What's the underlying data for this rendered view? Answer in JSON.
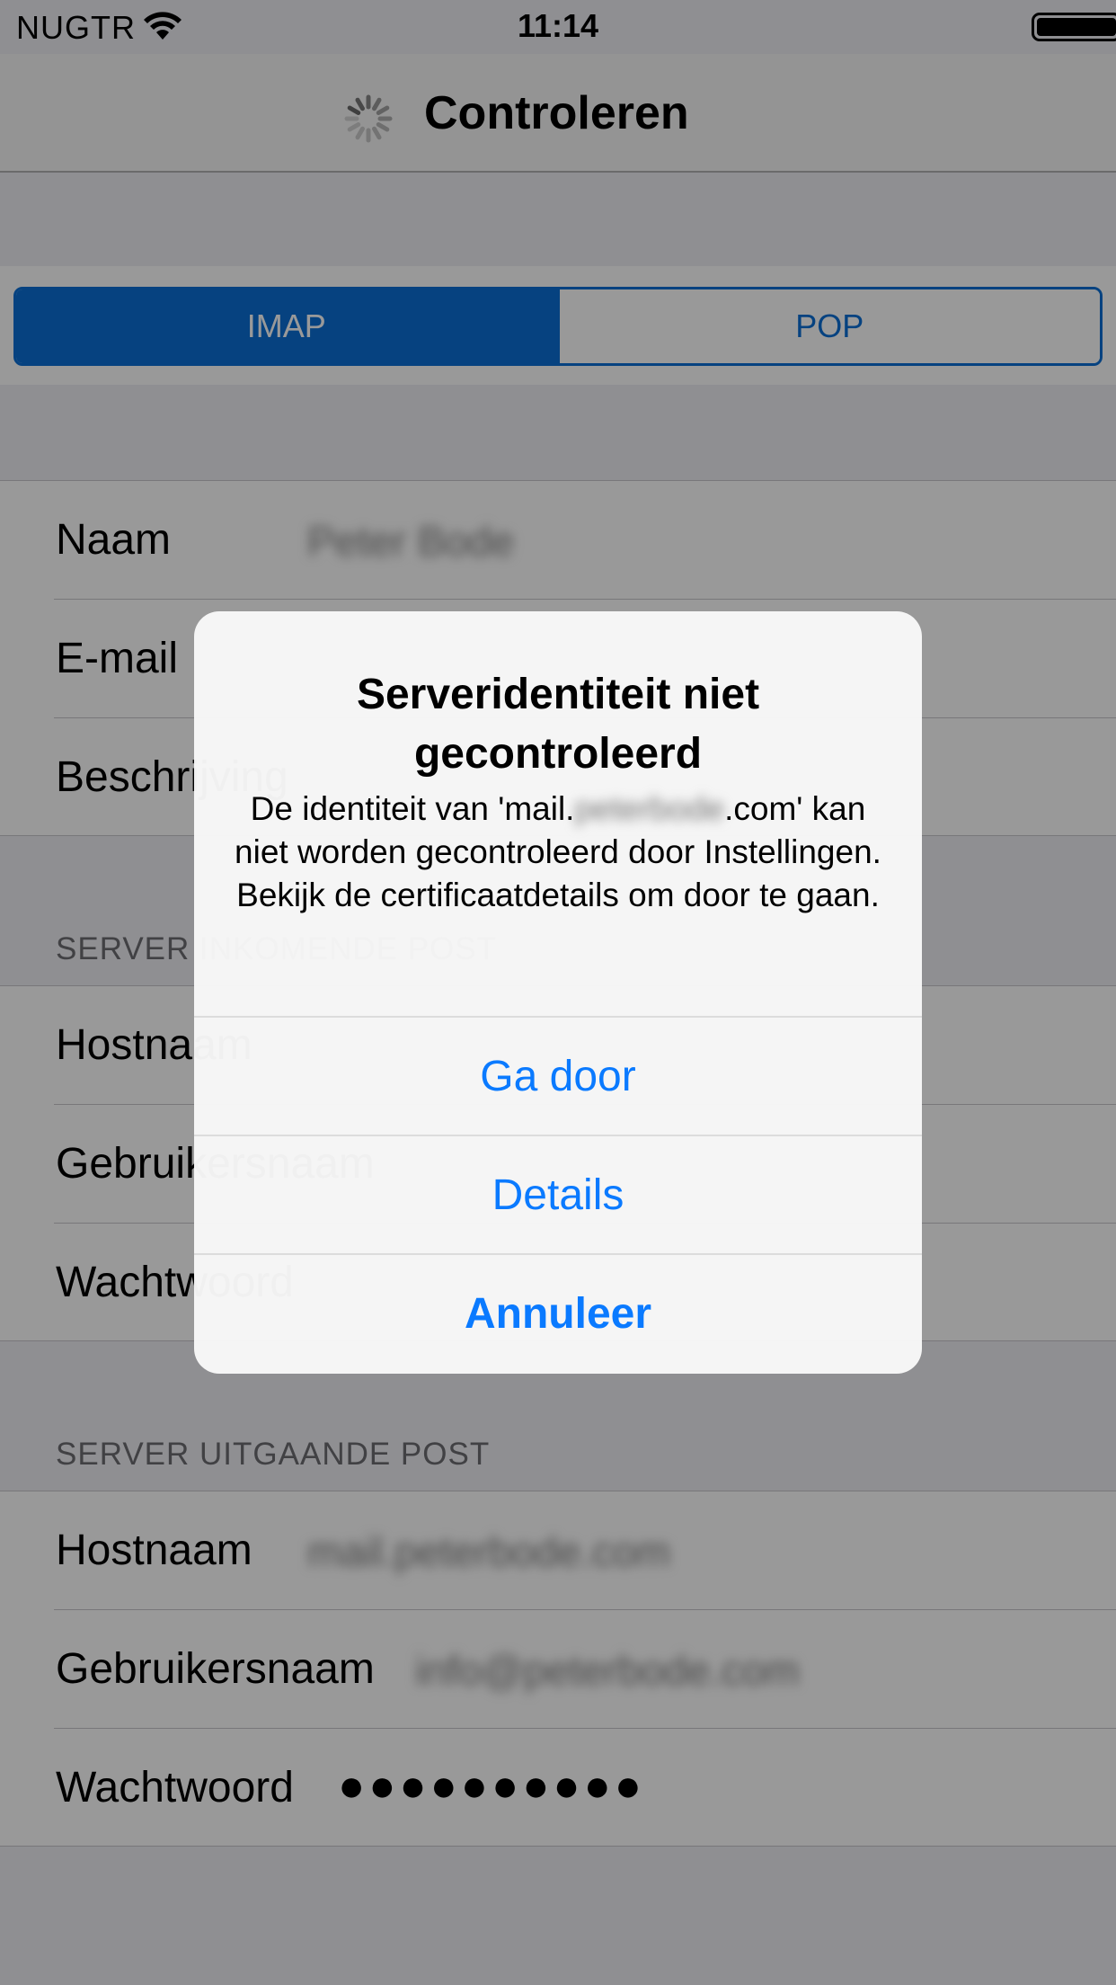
{
  "status_bar": {
    "carrier": "NUGTR",
    "time": "11:14"
  },
  "nav": {
    "title": "Controleren"
  },
  "segments": [
    "IMAP",
    "POP"
  ],
  "account": {
    "rows": [
      {
        "label": "Naam",
        "value": "Peter Bode"
      },
      {
        "label": "E-mail",
        "value": ""
      },
      {
        "label": "Beschrijving",
        "value": ""
      }
    ]
  },
  "incoming": {
    "header": "SERVER INKOMENDE POST",
    "rows": [
      {
        "label": "Hostnaam",
        "value": ""
      },
      {
        "label": "Gebruikersnaam",
        "value": ""
      },
      {
        "label": "Wachtwoord",
        "value": ""
      }
    ]
  },
  "outgoing": {
    "header": "SERVER UITGAANDE POST",
    "rows": [
      {
        "label": "Hostnaam",
        "value": "mail.peterbode.com"
      },
      {
        "label": "Gebruikersnaam",
        "value": "info@peterbode.com"
      },
      {
        "label": "Wachtwoord",
        "value": "●●●●●●●●●●"
      }
    ]
  },
  "alert": {
    "title_line1": "Serveridentiteit niet",
    "title_line2": "gecontroleerd",
    "msg_prefix": "De identiteit van 'mail.",
    "msg_blurred": "peterbode",
    "msg_suffix": ".com'",
    "msg_rest": "kan niet worden gecontroleerd door Instellingen. Bekijk de certificaatdetails om door te gaan.",
    "buttons": [
      "Ga door",
      "Details",
      "Annuleer"
    ]
  },
  "colors": {
    "accent": "#0a7aff",
    "segment": "#0a6fd6"
  }
}
